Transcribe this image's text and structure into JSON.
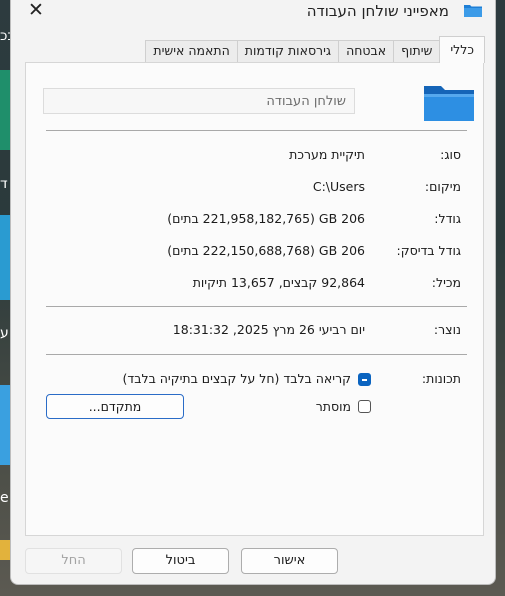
{
  "window": {
    "title": "מאפייני שולחן העבודה",
    "close_glyph": "✕"
  },
  "tabs": [
    {
      "label": "כללי",
      "active": true
    },
    {
      "label": "שיתוף",
      "active": false
    },
    {
      "label": "אבטחה",
      "active": false
    },
    {
      "label": "גירסאות קודמות",
      "active": false
    },
    {
      "label": "התאמה אישית",
      "active": false
    }
  ],
  "general": {
    "name_value": "שולחן העבודה",
    "type": {
      "label": "סוג:",
      "value": "תיקיית מערכת"
    },
    "location": {
      "label": "מיקום:",
      "value": "C:\\Users"
    },
    "size": {
      "label": "גודל:",
      "value": "206 GB (221,958,182,765 בתים)"
    },
    "size_on_disk": {
      "label": "גודל בדיסק:",
      "value": "206 GB (222,150,688,768 בתים)"
    },
    "contains": {
      "label": "מכיל:",
      "value": "92,864 קבצים, 13,657 תיקיות"
    },
    "created": {
      "label": "נוצר:",
      "value": "יום רביעי 26 מרץ 2025, 18:31:32"
    },
    "attributes": {
      "label": "תכונות:",
      "readonly_label": "קריאה בלבד (חל על קבצים בתיקיה בלבד)",
      "readonly_state": "indeterminate",
      "hidden_label": "מוסתר",
      "hidden_state": "unchecked",
      "advanced_label": "מתקדם..."
    }
  },
  "buttons": {
    "ok": "אישור",
    "cancel": "ביטול",
    "apply": "החל"
  },
  "desktop_fragments": {
    "text1": "ככ",
    "text2": "ד",
    "text3": "הע",
    "text4": "eD"
  },
  "colors": {
    "accent": "#0b64c0",
    "folder": "#1e7fd6"
  }
}
